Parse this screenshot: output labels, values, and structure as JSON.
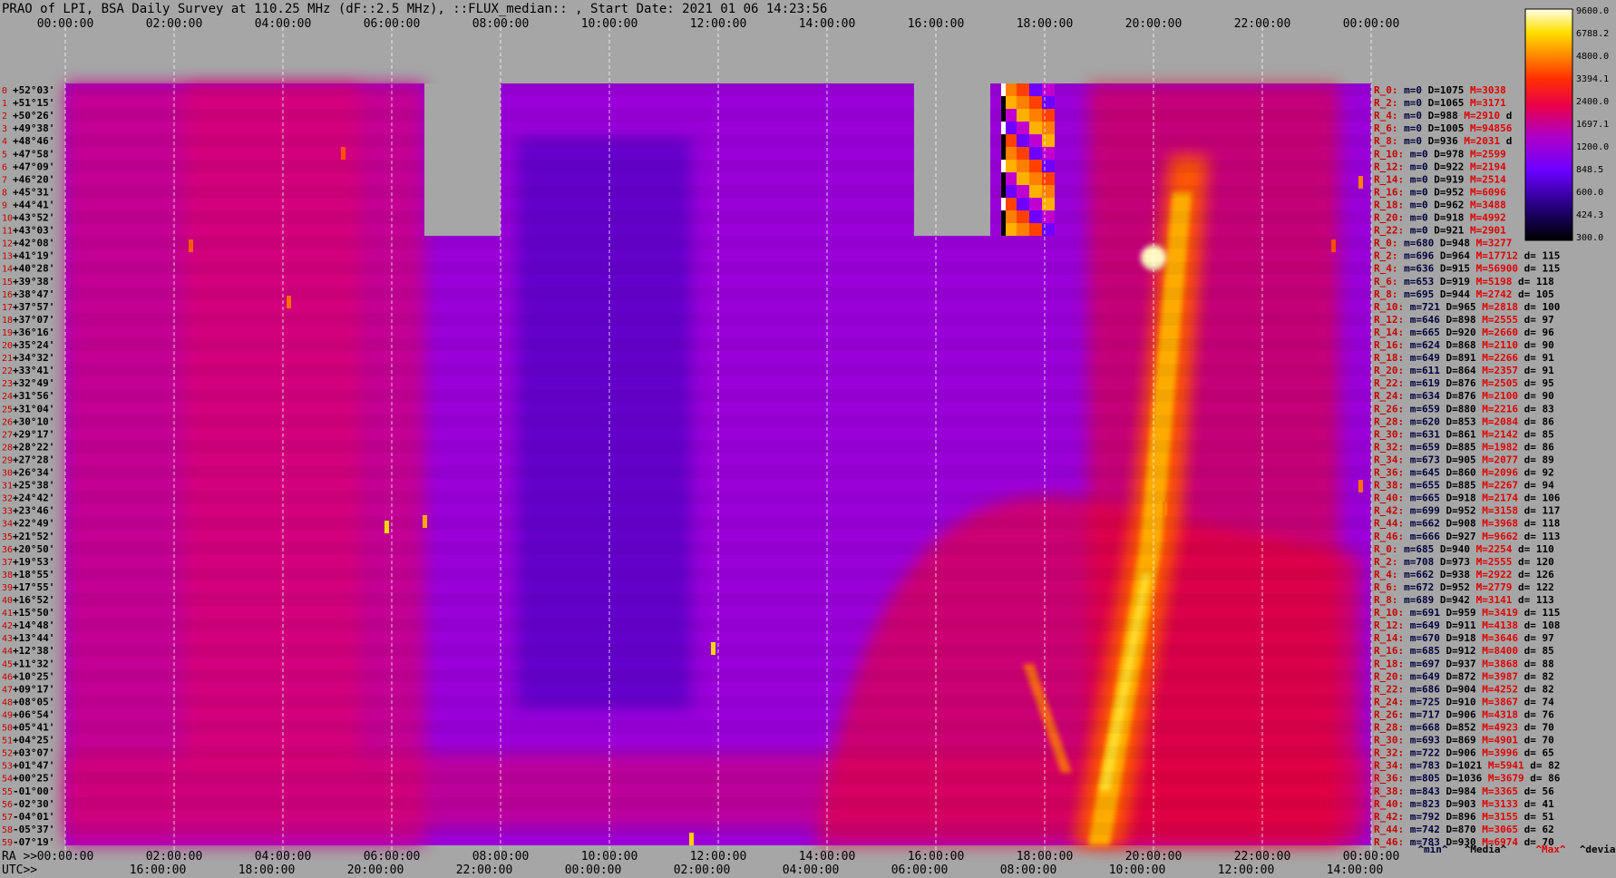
{
  "header": {
    "title": "PRAO of LPI, BSA Daily Survey at 110.25 MHz (dF::2.5 MHz), ::FLUX_median:: , Start Date: 2021 01 06 14:23:56"
  },
  "chart_data": {
    "type": "heatmap",
    "title": "PRAO of LPI, BSA Daily Survey at 110.25 MHz (dF::2.5 MHz), ::FLUX_median:: , Start Date: 2021 01 06 14:23:56",
    "top_time_ticks": [
      "00:00:00",
      "02:00:00",
      "04:00:00",
      "06:00:00",
      "08:00:00",
      "10:00:00",
      "12:00:00",
      "14:00:00",
      "16:00:00",
      "18:00:00",
      "20:00:00",
      "22:00:00",
      "00:00:00"
    ],
    "ra_label": "RA >>",
    "ra_ticks": [
      "00:00:00",
      "02:00:00",
      "04:00:00",
      "06:00:00",
      "08:00:00",
      "10:00:00",
      "12:00:00",
      "14:00:00",
      "16:00:00",
      "18:00:00",
      "20:00:00",
      "22:00:00",
      "00:00:00"
    ],
    "utc_label": "UTC>>",
    "utc_ticks": [
      "16:00:00",
      "18:00:00",
      "20:00:00",
      "22:00:00",
      "00:00:00",
      "02:00:00",
      "04:00:00",
      "06:00:00",
      "08:00:00",
      "10:00:00",
      "12:00:00",
      "14:00:00"
    ],
    "colorbar_ticks": [
      "9600.0",
      "6788.2",
      "4800.0",
      "3394.1",
      "2400.0",
      "1697.1",
      "1200.0",
      "848.5",
      "600.0",
      "424.3",
      "300.0"
    ],
    "colorbar_range": [
      300,
      9600
    ],
    "colorbar_scale": "log",
    "gaps_ra_hours": [
      [
        6.6,
        8.0
      ],
      [
        15.6,
        17.0
      ]
    ],
    "bright_ridge": {
      "ra_start": 18.5,
      "ra_end": 20.2,
      "description_only": false
    },
    "declinations": [
      "+52°03'",
      "+51°15'",
      "+50°26'",
      "+49°38'",
      "+48°46'",
      "+47°58'",
      "+47°09'",
      "+46°20'",
      "+45°31'",
      "+44°41'",
      "+43°52'",
      "+43°03'",
      "+42°08'",
      "+41°19'",
      "+40°28'",
      "+39°38'",
      "+38°47'",
      "+37°57'",
      "+37°07'",
      "+36°16'",
      "+35°24'",
      "+34°32'",
      "+33°41'",
      "+32°49'",
      "+31°56'",
      "+31°04'",
      "+30°10'",
      "+29°17'",
      "+28°22'",
      "+27°28'",
      "+26°34'",
      "+25°38'",
      "+24°42'",
      "+23°46'",
      "+22°49'",
      "+21°52'",
      "+20°50'",
      "+19°53'",
      "+18°55'",
      "+17°55'",
      "+16°52'",
      "+15°50'",
      "+14°48'",
      "+13°44'",
      "+12°38'",
      "+11°32'",
      "+10°25'",
      "+09°17'",
      "+08°05'",
      "+06°54'",
      "+05°41'",
      "+04°25'",
      "+03°07'",
      "+01°47'",
      "+00°25'",
      "-01°00'",
      "-02°30'",
      "-04°01'",
      "-05°37'",
      "-07°19'"
    ],
    "legend_rows": [
      {
        "r": "R_0:",
        "m": "m=0",
        "D": "D=1075",
        "M": "M=3038",
        "d": "",
        "mc": "#00003c"
      },
      {
        "r": "R_2:",
        "m": "m=0",
        "D": "D=1065",
        "M": "M=3171",
        "d": "",
        "mc": "#00003c"
      },
      {
        "r": "R_4:",
        "m": "m=0",
        "D": "D=988",
        "M": "M=2910",
        "d": "d",
        "mc": "#00003c"
      },
      {
        "r": "R_6:",
        "m": "m=0",
        "D": "D=1005",
        "M": "M=94856",
        "d": "",
        "mc": "#00003c"
      },
      {
        "r": "R_8:",
        "m": "m=0",
        "D": "D=936",
        "M": "M=2031",
        "d": "d",
        "mc": "#00003c"
      },
      {
        "r": "R_10:",
        "m": "m=0",
        "D": "D=978",
        "M": "M=2599",
        "d": "",
        "mc": "#00003c"
      },
      {
        "r": "R_12:",
        "m": "m=0",
        "D": "D=922",
        "M": "M=2194",
        "d": "",
        "mc": "#00003c"
      },
      {
        "r": "R_14:",
        "m": "m=0",
        "D": "D=919",
        "M": "M=2514",
        "d": "",
        "mc": "#00003c"
      },
      {
        "r": "R_16:",
        "m": "m=0",
        "D": "D=952",
        "M": "M=6096",
        "d": "",
        "mc": "#00003c"
      },
      {
        "r": "R_18:",
        "m": "m=0",
        "D": "D=962",
        "M": "M=3488",
        "d": "",
        "mc": "#00003c"
      },
      {
        "r": "R_20:",
        "m": "m=0",
        "D": "D=918",
        "M": "M=4992",
        "d": "",
        "mc": "#00003c"
      },
      {
        "r": "R_22:",
        "m": "m=0",
        "D": "D=921",
        "M": "M=2901",
        "d": "",
        "mc": "#00003c"
      },
      {
        "r": "R_0:",
        "m": "m=680",
        "D": "D=948",
        "M": "M=3277",
        "d": "",
        "mc": "#00003c"
      },
      {
        "r": "R_2:",
        "m": "m=696",
        "D": "D=964",
        "M": "M=17712",
        "d": "d= 115",
        "mc": "#00003c"
      },
      {
        "r": "R_4:",
        "m": "m=636",
        "D": "D=915",
        "M": "M=56900",
        "d": "d= 115",
        "mc": "#00003c"
      },
      {
        "r": "R_6:",
        "m": "m=653",
        "D": "D=919",
        "M": "M=5198",
        "d": "d= 118",
        "mc": "#00003c"
      },
      {
        "r": "R_8:",
        "m": "m=695",
        "D": "D=944",
        "M": "M=2742",
        "d": "d= 105",
        "mc": "#00003c"
      },
      {
        "r": "R_10:",
        "m": "m=721",
        "D": "D=965",
        "M": "M=2818",
        "d": "d= 100",
        "mc": "#00003c"
      },
      {
        "r": "R_12:",
        "m": "m=646",
        "D": "D=898",
        "M": "M=2555",
        "d": "d= 97",
        "mc": "#00003c"
      },
      {
        "r": "R_14:",
        "m": "m=665",
        "D": "D=920",
        "M": "M=2660",
        "d": "d= 96",
        "mc": "#00003c"
      },
      {
        "r": "R_16:",
        "m": "m=624",
        "D": "D=868",
        "M": "M=2110",
        "d": "d= 90",
        "mc": "#00003c"
      },
      {
        "r": "R_18:",
        "m": "m=649",
        "D": "D=891",
        "M": "M=2266",
        "d": "d= 91",
        "mc": "#00003c"
      },
      {
        "r": "R_20:",
        "m": "m=611",
        "D": "D=864",
        "M": "M=2357",
        "d": "d= 91",
        "mc": "#00003c"
      },
      {
        "r": "R_22:",
        "m": "m=619",
        "D": "D=876",
        "M": "M=2505",
        "d": "d= 95",
        "mc": "#00003c"
      },
      {
        "r": "R_24:",
        "m": "m=634",
        "D": "D=876",
        "M": "M=2100",
        "d": "d= 90",
        "mc": "#00003c"
      },
      {
        "r": "R_26:",
        "m": "m=659",
        "D": "D=880",
        "M": "M=2216",
        "d": "d= 83",
        "mc": "#00003c"
      },
      {
        "r": "R_28:",
        "m": "m=620",
        "D": "D=853",
        "M": "M=2084",
        "d": "d= 86",
        "mc": "#00003c"
      },
      {
        "r": "R_30:",
        "m": "m=631",
        "D": "D=861",
        "M": "M=2142",
        "d": "d= 85",
        "mc": "#00003c"
      },
      {
        "r": "R_32:",
        "m": "m=659",
        "D": "D=885",
        "M": "M=1982",
        "d": "d= 86",
        "mc": "#00003c"
      },
      {
        "r": "R_34:",
        "m": "m=673",
        "D": "D=905",
        "M": "M=2077",
        "d": "d= 89",
        "mc": "#00003c"
      },
      {
        "r": "R_36:",
        "m": "m=645",
        "D": "D=860",
        "M": "M=2096",
        "d": "d= 92",
        "mc": "#00003c"
      },
      {
        "r": "R_38:",
        "m": "m=655",
        "D": "D=885",
        "M": "M=2267",
        "d": "d= 94",
        "mc": "#00003c"
      },
      {
        "r": "R_40:",
        "m": "m=665",
        "D": "D=918",
        "M": "M=2174",
        "d": "d= 106",
        "mc": "#00003c"
      },
      {
        "r": "R_42:",
        "m": "m=699",
        "D": "D=952",
        "M": "M=3158",
        "d": "d= 117",
        "mc": "#00003c"
      },
      {
        "r": "R_44:",
        "m": "m=662",
        "D": "D=908",
        "M": "M=3968",
        "d": "d= 118",
        "mc": "#00003c"
      },
      {
        "r": "R_46:",
        "m": "m=666",
        "D": "D=927",
        "M": "M=9662",
        "d": "d= 113",
        "mc": "#00003c"
      },
      {
        "r": "R_0:",
        "m": "m=685",
        "D": "D=940",
        "M": "M=2254",
        "d": "d= 110",
        "mc": "#00003c"
      },
      {
        "r": "R_2:",
        "m": "m=708",
        "D": "D=973",
        "M": "M=2555",
        "d": "d= 120",
        "mc": "#00003c"
      },
      {
        "r": "R_4:",
        "m": "m=662",
        "D": "D=938",
        "M": "M=2922",
        "d": "d= 126",
        "mc": "#00003c"
      },
      {
        "r": "R_6:",
        "m": "m=672",
        "D": "D=952",
        "M": "M=2779",
        "d": "d= 122",
        "mc": "#00003c"
      },
      {
        "r": "R_8:",
        "m": "m=689",
        "D": "D=942",
        "M": "M=3141",
        "d": "d= 113",
        "mc": "#00003c"
      },
      {
        "r": "R_10:",
        "m": "m=691",
        "D": "D=959",
        "M": "M=3419",
        "d": "d= 115",
        "mc": "#00003c"
      },
      {
        "r": "R_12:",
        "m": "m=649",
        "D": "D=911",
        "M": "M=4138",
        "d": "d= 108",
        "mc": "#00003c"
      },
      {
        "r": "R_14:",
        "m": "m=670",
        "D": "D=918",
        "M": "M=3646",
        "d": "d= 97",
        "mc": "#00003c"
      },
      {
        "r": "R_16:",
        "m": "m=685",
        "D": "D=912",
        "M": "M=8400",
        "d": "d= 85",
        "mc": "#00003c"
      },
      {
        "r": "R_18:",
        "m": "m=697",
        "D": "D=937",
        "M": "M=3868",
        "d": "d= 88",
        "mc": "#00003c"
      },
      {
        "r": "R_20:",
        "m": "m=649",
        "D": "D=872",
        "M": "M=3987",
        "d": "d= 82",
        "mc": "#00003c"
      },
      {
        "r": "R_22:",
        "m": "m=686",
        "D": "D=904",
        "M": "M=4252",
        "d": "d= 82",
        "mc": "#00003c"
      },
      {
        "r": "R_24:",
        "m": "m=725",
        "D": "D=910",
        "M": "M=3867",
        "d": "d= 74",
        "mc": "#00003c"
      },
      {
        "r": "R_26:",
        "m": "m=717",
        "D": "D=906",
        "M": "M=4318",
        "d": "d= 76",
        "mc": "#00003c"
      },
      {
        "r": "R_28:",
        "m": "m=668",
        "D": "D=852",
        "M": "M=4923",
        "d": "d= 70",
        "mc": "#00003c"
      },
      {
        "r": "R_30:",
        "m": "m=693",
        "D": "D=869",
        "M": "M=4901",
        "d": "d= 70",
        "mc": "#00003c"
      },
      {
        "r": "R_32:",
        "m": "m=722",
        "D": "D=906",
        "M": "M=3996",
        "d": "d= 65",
        "mc": "#00003c"
      },
      {
        "r": "R_34:",
        "m": "m=783",
        "D": "D=1021",
        "M": "M=5941",
        "d": "d= 82",
        "mc": "#00003c"
      },
      {
        "r": "R_36:",
        "m": "m=805",
        "D": "D=1036",
        "M": "M=3679",
        "d": "d= 86",
        "mc": "#00003c"
      },
      {
        "r": "R_38:",
        "m": "m=843",
        "D": "D=984",
        "M": "M=3365",
        "d": "d= 56",
        "mc": "#00003c"
      },
      {
        "r": "R_40:",
        "m": "m=823",
        "D": "D=903",
        "M": "M=3133",
        "d": "d= 41",
        "mc": "#00003c"
      },
      {
        "r": "R_42:",
        "m": "m=792",
        "D": "D=896",
        "M": "M=3155",
        "d": "d= 51",
        "mc": "#00003c"
      },
      {
        "r": "R_44:",
        "m": "m=742",
        "D": "D=870",
        "M": "M=3065",
        "d": "d= 62",
        "mc": "#00003c"
      },
      {
        "r": "R_46:",
        "m": "m=783",
        "D": "D=930",
        "M": "M=6974",
        "d": "d= 70",
        "mc": "#00003c"
      }
    ],
    "legend_footer": [
      "^min^",
      "^Media^",
      "^Max^",
      "^devia^"
    ]
  },
  "colors": {
    "background": "#a6a6a6",
    "gap": "#a6a6a6",
    "row_label": "#c80000",
    "dec_label": "#000000",
    "legend_label": "#c80000",
    "legend_m": "#00003c",
    "legend_M": "#e00000"
  }
}
